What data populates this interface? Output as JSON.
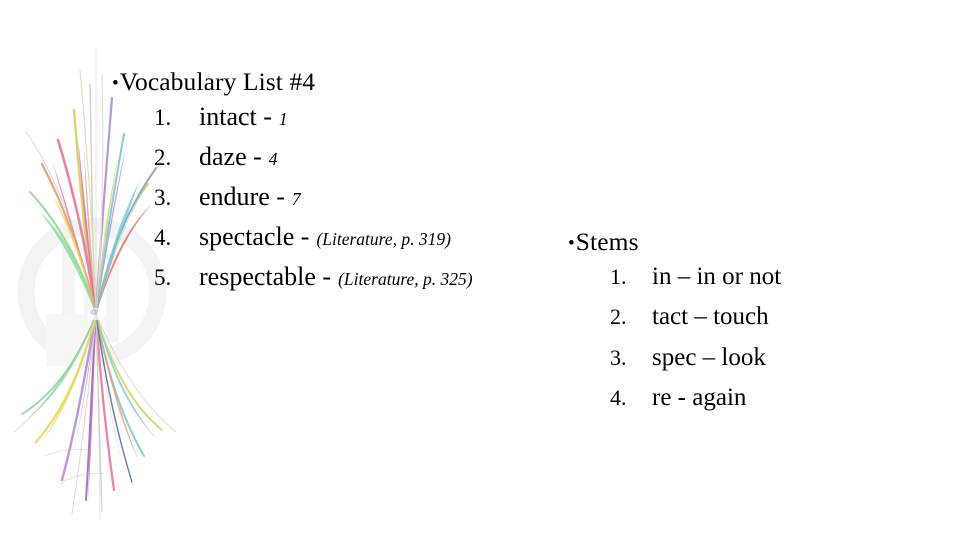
{
  "slide": {
    "background_color": "#ffffff",
    "text_color": "#000000"
  },
  "decoration": {
    "name": "abstract-feather-floral-clipart",
    "description": "Pastel multicolored feathery floral burst graphic along the left edge",
    "palette": [
      "#e87a9e",
      "#d45fa8",
      "#b48fd4",
      "#8f6fc4",
      "#e8d860",
      "#c9d65e",
      "#8fd89a",
      "#7cc8d4",
      "#6fa8d0",
      "#e8a070",
      "#e06a5a",
      "#4a6fa5"
    ],
    "watermark_color": "#ededed"
  },
  "left_column": {
    "bullet": "•",
    "heading": "Vocabulary List #4",
    "items": [
      {
        "num": "1.",
        "term": "intact -",
        "cite": "1"
      },
      {
        "num": "2.",
        "term": "daze -",
        "cite": "4"
      },
      {
        "num": "3.",
        "term": "endure -",
        "cite": "7"
      },
      {
        "num": "4.",
        "term": "spectacle -",
        "cite": "(Literature, p. 319)"
      },
      {
        "num": "5.",
        "term": "respectable -",
        "cite": "(Literature, p. 325)"
      }
    ]
  },
  "right_column": {
    "bullet": "•",
    "heading": "Stems",
    "items": [
      {
        "num": "1.",
        "term": "in – in or not"
      },
      {
        "num": "2.",
        "term": "tact – touch"
      },
      {
        "num": "3.",
        "term": "spec – look"
      },
      {
        "num": "4.",
        "term": "re - again"
      }
    ]
  }
}
